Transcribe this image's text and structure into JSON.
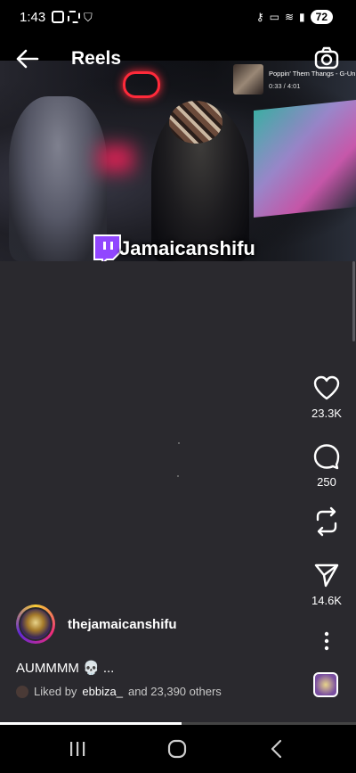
{
  "status_bar": {
    "time": "1:43",
    "battery": "72"
  },
  "header": {
    "title": "Reels"
  },
  "music": {
    "song": "Poppin' Them Thangs - G-Unit",
    "time": "0:33 / 4:01"
  },
  "overlay": {
    "channel_name": "Jamaicanshifu"
  },
  "actions": {
    "likes": "23.3K",
    "comments": "250",
    "shares": "14.6K"
  },
  "author": {
    "username": "thejamaicanshifu"
  },
  "caption": "AUMMMM 💀 ...",
  "liked_by": {
    "prefix": "Liked by",
    "user": "ebbiza_",
    "suffix": "and 23,390 others"
  },
  "progress": {
    "fraction": 0.51
  },
  "icons": {
    "back": "arrow-left-icon",
    "camera": "camera-icon",
    "like": "heart-icon",
    "comment": "comment-bubble-icon",
    "remix": "remix-icon",
    "share": "send-icon",
    "more": "more-vertical-icon"
  }
}
